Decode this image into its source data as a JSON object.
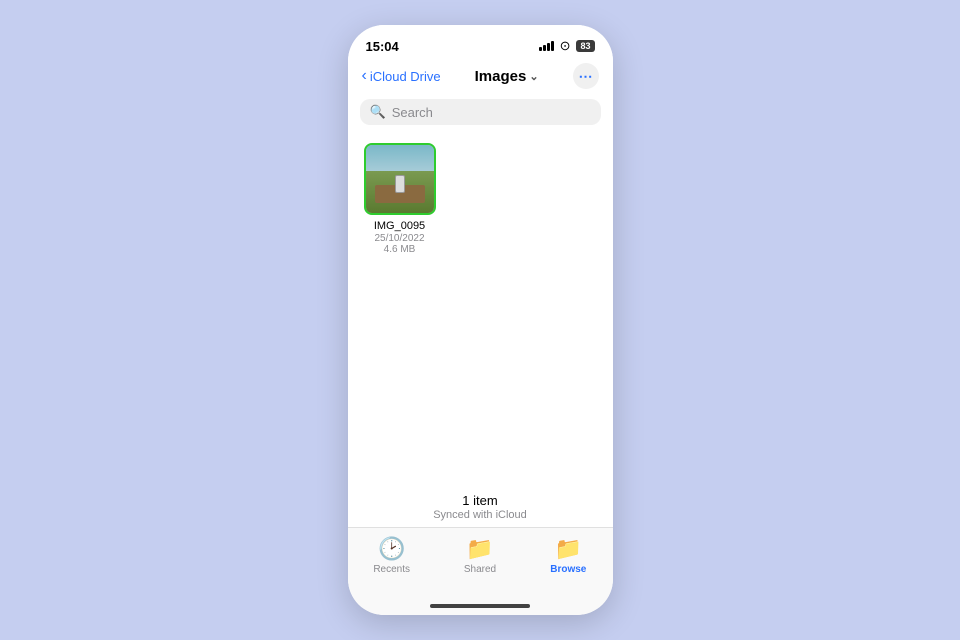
{
  "status_bar": {
    "time": "15:04",
    "battery": "83"
  },
  "nav": {
    "back_label": "iCloud Drive",
    "title": "Images",
    "more_icon": "ellipsis"
  },
  "search": {
    "placeholder": "Search"
  },
  "files": [
    {
      "name": "IMG_0095",
      "date": "25/10/2022",
      "size": "4.6 MB"
    }
  ],
  "footer": {
    "item_count": "1 item",
    "sync_status": "Synced with iCloud"
  },
  "tabs": [
    {
      "id": "recents",
      "label": "Recents",
      "active": false
    },
    {
      "id": "shared",
      "label": "Shared",
      "active": false
    },
    {
      "id": "browse",
      "label": "Browse",
      "active": true
    }
  ]
}
